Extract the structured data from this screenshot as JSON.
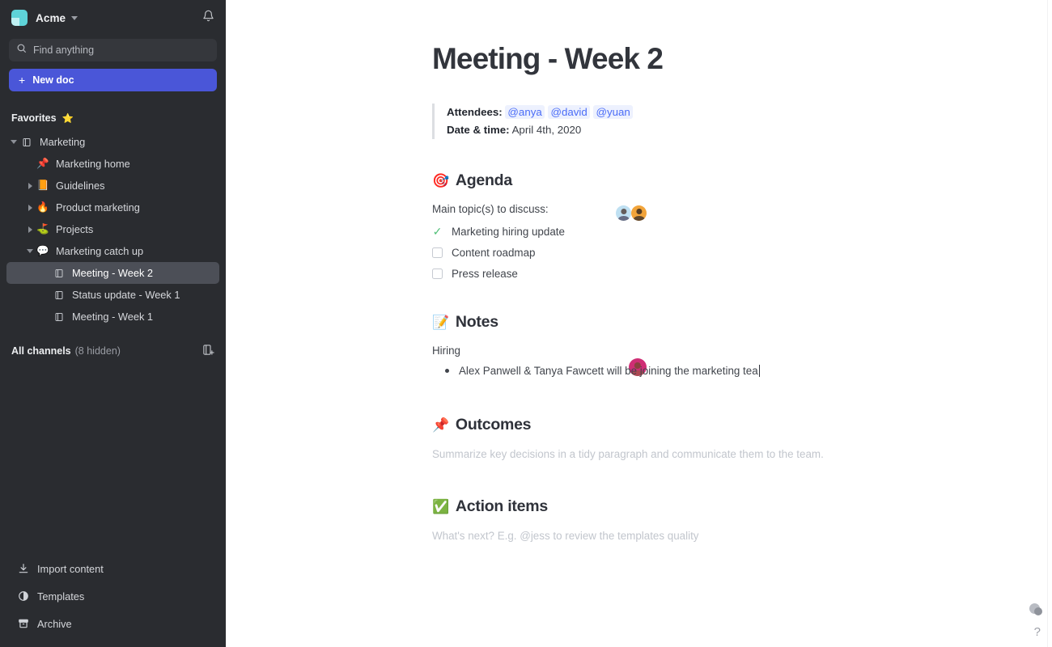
{
  "sidebar": {
    "workspace": {
      "name": "Acme",
      "logo_icon": "acme-logo",
      "caret_icon": "chevron-down-icon",
      "bell_icon": "bell-icon"
    },
    "search": {
      "placeholder": "Find anything",
      "icon": "search-icon"
    },
    "new_doc": {
      "label": "New doc",
      "plus": "+",
      "color": "#4a56d8"
    },
    "favorites": {
      "label": "Favorites",
      "star": "⭐"
    },
    "tree": [
      {
        "label": "Marketing",
        "icon": "📄",
        "icon_name": "doc-panel-icon",
        "depth": 0,
        "twisty": "down",
        "selected": false
      },
      {
        "label": "Marketing home",
        "icon": "📌",
        "icon_name": "pushpin-emoji",
        "depth": 1,
        "twisty": "none",
        "selected": false
      },
      {
        "label": "Guidelines",
        "icon": "📙",
        "icon_name": "orange-book-emoji",
        "depth": 1,
        "twisty": "right",
        "selected": false
      },
      {
        "label": "Product marketing",
        "icon": "🔥",
        "icon_name": "fire-emoji",
        "depth": 1,
        "twisty": "right",
        "selected": false
      },
      {
        "label": "Projects",
        "icon": "⛳",
        "icon_name": "golf-flag-emoji",
        "depth": 1,
        "twisty": "right",
        "selected": false
      },
      {
        "label": "Marketing catch up",
        "icon": "💬",
        "icon_name": "speech-balloon-emoji",
        "depth": 1,
        "twisty": "down",
        "selected": false
      },
      {
        "label": "Meeting - Week 2",
        "icon": "📄",
        "icon_name": "doc-icon",
        "depth": 2,
        "twisty": "none",
        "selected": true
      },
      {
        "label": "Status update - Week 1",
        "icon": "📄",
        "icon_name": "doc-icon",
        "depth": 2,
        "twisty": "none",
        "selected": false
      },
      {
        "label": "Meeting - Week 1",
        "icon": "📄",
        "icon_name": "doc-icon",
        "depth": 2,
        "twisty": "none",
        "selected": false
      }
    ],
    "all_channels": {
      "label": "All channels",
      "meta": "(8 hidden)",
      "add_icon": "add-channel-icon"
    },
    "bottom": [
      {
        "label": "Import content",
        "icon_name": "import-download-icon"
      },
      {
        "label": "Templates",
        "icon_name": "templates-icon"
      },
      {
        "label": "Archive",
        "icon_name": "archive-box-icon"
      }
    ]
  },
  "document": {
    "title": "Meeting - Week 2",
    "meta": {
      "attendees_label": "Attendees:",
      "attendees": [
        "@anya",
        "@david",
        "@yuan"
      ],
      "date_label": "Date & time:",
      "date_value": "April 4th, 2020"
    },
    "agenda": {
      "emoji": "🎯",
      "heading": "Agenda",
      "intro": "Main topic(s) to discuss:",
      "items": [
        {
          "label": "Marketing hiring update",
          "checked": true
        },
        {
          "label": "Content roadmap",
          "checked": false
        },
        {
          "label": "Press release",
          "checked": false
        }
      ]
    },
    "notes": {
      "emoji": "📝",
      "heading": "Notes",
      "subhead": "Hiring",
      "bullets": [
        "Alex Panwell & Tanya Fawcett will be joining the marketing tea"
      ]
    },
    "outcomes": {
      "emoji": "📌",
      "heading": "Outcomes",
      "placeholder": "Summarize key decisions in a tidy paragraph and communicate them to the team."
    },
    "action_items": {
      "emoji": "✅",
      "heading": "Action items",
      "placeholder": "What's next? E.g. @jess to review the templates quality"
    },
    "help": {
      "question_mark": "?"
    }
  },
  "colors": {
    "accent": "#4a56d8",
    "mention": "#4a6cf7",
    "check_green": "#53c07a",
    "sidebar_bg": "#2a2c30"
  }
}
